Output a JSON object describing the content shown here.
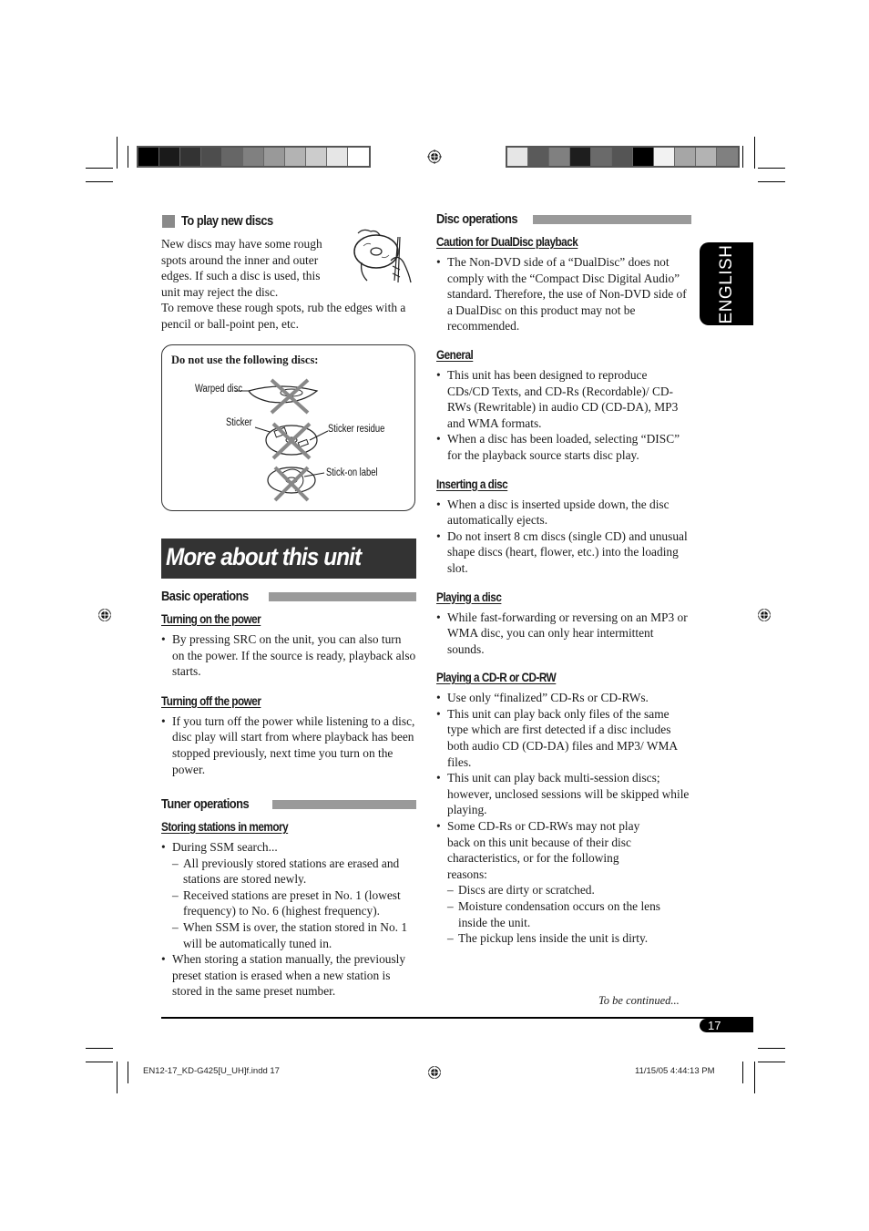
{
  "print_marks": {
    "color_bar_left": [
      "#000000",
      "#1a1a1a",
      "#333333",
      "#4d4d4d",
      "#666666",
      "#808080",
      "#999999",
      "#b3b3b3",
      "#cccccc",
      "#e6e6e6",
      "#ffffff"
    ],
    "color_bar_right": [
      "#e6e6e6",
      "#5a5a5a",
      "#808080",
      "#1e1e1e",
      "#6a6a6a",
      "#555555",
      "#000000",
      "#f2f2f2",
      "#a6a6a6",
      "#b3b3b3",
      "#808080"
    ],
    "slug_left": "EN12-17_KD-G425[U_UH]f.indd   17",
    "slug_right": "11/15/05   4:44:13 PM"
  },
  "language_tab": "ENGLISH",
  "left_column": {
    "play_new_discs": {
      "heading": "To play new discs",
      "para1": "New discs may have some rough spots around the inner and outer edges. If such a disc is used, this unit may reject the disc.",
      "para2": "To remove these rough spots, rub the edges with a pencil or ball-point pen, etc.",
      "illustration": "hand-rubbing-disc-edge-with-pen"
    },
    "do_not_use": {
      "title": "Do not use the following discs:",
      "items": [
        {
          "label": "Warped disc",
          "icon": "warped-disc-crossed"
        },
        {
          "label": "Sticker",
          "icon": "sticker-disc-crossed"
        },
        {
          "label": "Sticker residue",
          "icon": "sticker-residue"
        },
        {
          "label": "Stick-on label",
          "icon": "stick-on-label-disc-crossed"
        }
      ]
    },
    "chapter_title": "More about this unit",
    "basic_operations": {
      "heading": "Basic operations",
      "turning_on": {
        "heading": "Turning on the power",
        "bullets": [
          "By pressing SRC on the unit, you can also turn on the power. If the source is ready, playback also starts."
        ]
      },
      "turning_off": {
        "heading": "Turning off the power",
        "bullets": [
          "If you turn off the power while listening to a disc, disc play will start from where playback has been stopped previously, next time you turn on the power."
        ]
      }
    },
    "tuner_operations": {
      "heading": "Tuner operations",
      "storing": {
        "heading": "Storing stations in memory",
        "bullet1": "During SSM search...",
        "dashes": [
          "All previously stored stations are erased and stations are stored newly.",
          "Received stations are preset in No. 1 (lowest frequency) to No. 6 (highest frequency).",
          "When SSM is over, the station stored in No. 1 will be automatically tuned in."
        ],
        "bullet2": "When storing a station manually, the previously preset station is erased when a new station is stored in the same preset number."
      }
    }
  },
  "right_column": {
    "disc_operations": {
      "heading": "Disc operations",
      "caution": {
        "heading": "Caution for DualDisc playback",
        "bullets": [
          "The Non-DVD side of a “DualDisc” does not comply with the “Compact Disc Digital Audio” standard. Therefore, the use of Non-DVD side of a DualDisc on this product may not be recommended."
        ]
      },
      "general": {
        "heading": "General",
        "bullets": [
          "This unit has been designed to reproduce CDs/CD Texts, and CD-Rs (Recordable)/ CD-RWs (Rewritable) in audio CD (CD-DA), MP3 and WMA formats.",
          "When a disc has been loaded, selecting “DISC” for the playback source starts disc play."
        ]
      },
      "inserting": {
        "heading": "Inserting a disc",
        "bullets": [
          "When a disc is inserted upside down, the disc automatically ejects.",
          "Do not insert 8 cm discs (single CD) and unusual shape discs (heart, flower, etc.) into the loading slot."
        ]
      },
      "playing": {
        "heading": "Playing a disc",
        "bullets": [
          "While fast-forwarding or reversing on an MP3 or WMA disc, you can only hear intermittent sounds."
        ]
      },
      "cdr": {
        "heading": "Playing a CD-R or CD-RW",
        "bullets": [
          "Use only “finalized” CD-Rs or CD-RWs.",
          "This unit can play back only files of the same type which are first detected if a disc includes both audio CD (CD-DA) files and MP3/ WMA files.",
          "This unit can play back multi-session discs; however, unclosed sessions will be skipped while playing.",
          "Some CD-Rs or CD-RWs may not play back on this unit because of their disc characteristics, or for the following reasons:"
        ],
        "dashes": [
          "Discs are dirty or scratched.",
          "Moisture condensation occurs on the lens inside the unit.",
          "The pickup lens inside the unit is dirty."
        ]
      }
    },
    "continued": "To be continued..."
  },
  "page_number": "17"
}
